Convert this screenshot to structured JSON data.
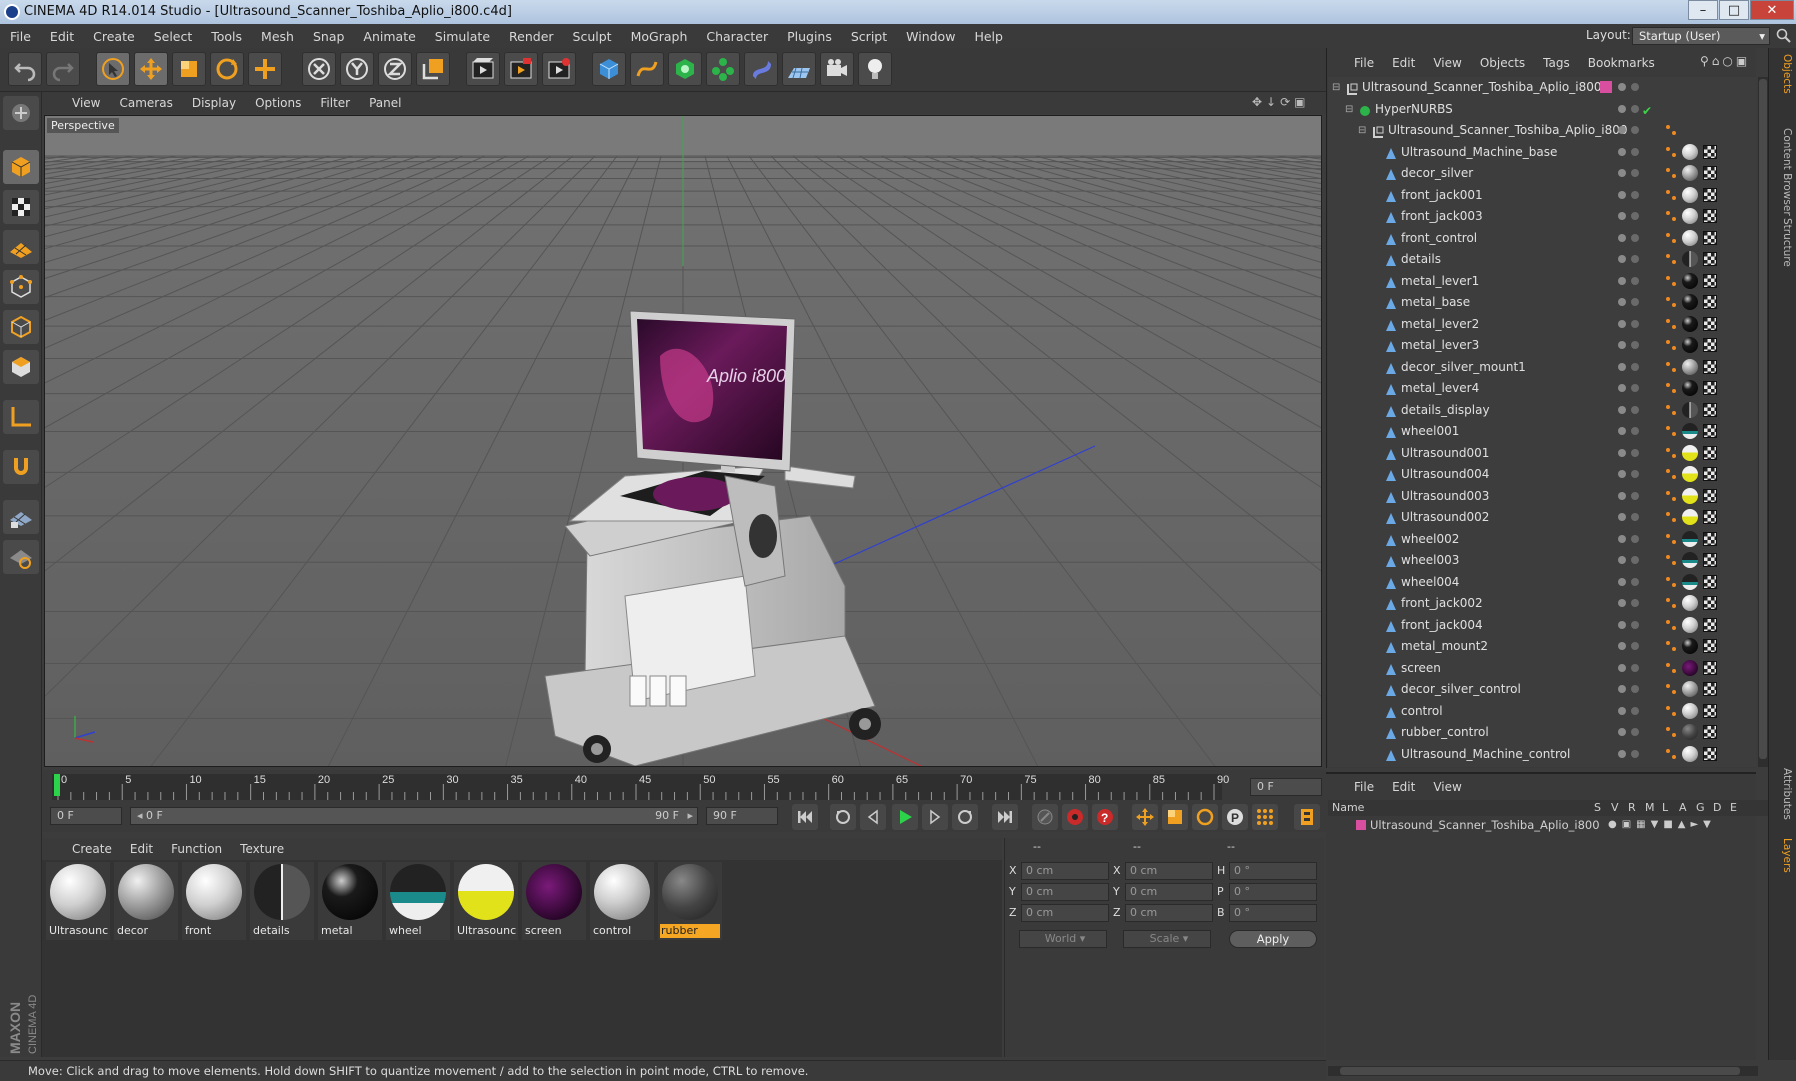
{
  "window": {
    "title": "CINEMA 4D R14.014 Studio - [Ultrasound_Scanner_Toshiba_Aplio_i800.c4d]"
  },
  "menubar": [
    "File",
    "Edit",
    "Create",
    "Select",
    "Tools",
    "Mesh",
    "Snap",
    "Animate",
    "Simulate",
    "Render",
    "Sculpt",
    "MoGraph",
    "Character",
    "Plugins",
    "Script",
    "Window",
    "Help"
  ],
  "layout": {
    "label": "Layout:",
    "value": "Startup (User)"
  },
  "viewport": {
    "menu": [
      "View",
      "Cameras",
      "Display",
      "Options",
      "Filter",
      "Panel"
    ],
    "label": "Perspective",
    "screen_text": "Aplio i800"
  },
  "timeline": {
    "ticks": [
      "0",
      "5",
      "10",
      "15",
      "20",
      "25",
      "30",
      "35",
      "40",
      "45",
      "50",
      "55",
      "60",
      "65",
      "70",
      "75",
      "80",
      "85",
      "90"
    ],
    "end_field": "0 F"
  },
  "playback": {
    "current": "0 F",
    "range_start": "0 F",
    "range_end": "90 F",
    "max": "90 F"
  },
  "materials": {
    "menu": [
      "Create",
      "Edit",
      "Function",
      "Texture"
    ],
    "items": [
      {
        "name": "Ultrasounc",
        "style": "white"
      },
      {
        "name": "decor",
        "style": "silver"
      },
      {
        "name": "front",
        "style": "white"
      },
      {
        "name": "details",
        "style": "details"
      },
      {
        "name": "metal",
        "style": "black"
      },
      {
        "name": "wheel",
        "style": "wheel"
      },
      {
        "name": "Ultrasounc",
        "style": "yellow"
      },
      {
        "name": "screen",
        "style": "screen"
      },
      {
        "name": "control",
        "style": "control"
      },
      {
        "name": "rubber",
        "style": "rubber"
      }
    ]
  },
  "coords": {
    "headers": [
      "--",
      "--",
      "--"
    ],
    "rows": [
      {
        "l1": "X",
        "v1": "0 cm",
        "l2": "X",
        "v2": "0 cm",
        "l3": "H",
        "v3": "0 °"
      },
      {
        "l1": "Y",
        "v1": "0 cm",
        "l2": "Y",
        "v2": "0 cm",
        "l3": "P",
        "v3": "0 °"
      },
      {
        "l1": "Z",
        "v1": "0 cm",
        "l2": "Z",
        "v2": "0 cm",
        "l3": "B",
        "v3": "0 °"
      }
    ],
    "world": "World",
    "scale": "Scale",
    "apply": "Apply"
  },
  "status": "Move: Click and drag to move elements. Hold down SHIFT to quantize movement / add to the selection in point mode, CTRL to remove.",
  "objects": {
    "menu": [
      "File",
      "Edit",
      "View",
      "Objects",
      "Tags",
      "Bookmarks"
    ],
    "rows": [
      {
        "name": "Ultrasound_Scanner_Toshiba_Aplio_i800",
        "indent": 0,
        "type": "null",
        "mat": "pink"
      },
      {
        "name": "HyperNURBS",
        "indent": 1,
        "type": "nurbs",
        "mat": "check"
      },
      {
        "name": "Ultrasound_Scanner_Toshiba_Aplio_i800",
        "indent": 2,
        "type": "null",
        "mat": "none"
      },
      {
        "name": "Ultrasound_Machine_base",
        "indent": 3,
        "type": "poly",
        "mat": "white"
      },
      {
        "name": "decor_silver",
        "indent": 3,
        "type": "poly",
        "mat": "silver"
      },
      {
        "name": "front_jack001",
        "indent": 3,
        "type": "poly",
        "mat": "white"
      },
      {
        "name": "front_jack003",
        "indent": 3,
        "type": "poly",
        "mat": "white"
      },
      {
        "name": "front_control",
        "indent": 3,
        "type": "poly",
        "mat": "white"
      },
      {
        "name": "details",
        "indent": 3,
        "type": "poly",
        "mat": "details"
      },
      {
        "name": "metal_lever1",
        "indent": 3,
        "type": "poly",
        "mat": "black"
      },
      {
        "name": "metal_base",
        "indent": 3,
        "type": "poly",
        "mat": "black"
      },
      {
        "name": "metal_lever2",
        "indent": 3,
        "type": "poly",
        "mat": "black"
      },
      {
        "name": "metal_lever3",
        "indent": 3,
        "type": "poly",
        "mat": "black"
      },
      {
        "name": "decor_silver_mount1",
        "indent": 3,
        "type": "poly",
        "mat": "silver"
      },
      {
        "name": "metal_lever4",
        "indent": 3,
        "type": "poly",
        "mat": "black"
      },
      {
        "name": "details_display",
        "indent": 3,
        "type": "poly",
        "mat": "details"
      },
      {
        "name": "wheel001",
        "indent": 3,
        "type": "poly",
        "mat": "wheel"
      },
      {
        "name": "Ultrasound001",
        "indent": 3,
        "type": "poly",
        "mat": "yellow"
      },
      {
        "name": "Ultrasound004",
        "indent": 3,
        "type": "poly",
        "mat": "yellow"
      },
      {
        "name": "Ultrasound003",
        "indent": 3,
        "type": "poly",
        "mat": "yellow"
      },
      {
        "name": "Ultrasound002",
        "indent": 3,
        "type": "poly",
        "mat": "yellow"
      },
      {
        "name": "wheel002",
        "indent": 3,
        "type": "poly",
        "mat": "wheel"
      },
      {
        "name": "wheel003",
        "indent": 3,
        "type": "poly",
        "mat": "wheel"
      },
      {
        "name": "wheel004",
        "indent": 3,
        "type": "poly",
        "mat": "wheel"
      },
      {
        "name": "front_jack002",
        "indent": 3,
        "type": "poly",
        "mat": "white"
      },
      {
        "name": "front_jack004",
        "indent": 3,
        "type": "poly",
        "mat": "white"
      },
      {
        "name": "metal_mount2",
        "indent": 3,
        "type": "poly",
        "mat": "black"
      },
      {
        "name": "screen",
        "indent": 3,
        "type": "poly",
        "mat": "screen"
      },
      {
        "name": "decor_silver_control",
        "indent": 3,
        "type": "poly",
        "mat": "silver"
      },
      {
        "name": "control",
        "indent": 3,
        "type": "poly",
        "mat": "control"
      },
      {
        "name": "rubber_control",
        "indent": 3,
        "type": "poly",
        "mat": "rubber"
      },
      {
        "name": "Ultrasound_Machine_control",
        "indent": 3,
        "type": "poly",
        "mat": "white"
      }
    ]
  },
  "layers": {
    "menu": [
      "File",
      "Edit",
      "View"
    ],
    "header_name": "Name",
    "cols": [
      "S",
      "V",
      "R",
      "M",
      "L",
      "A",
      "G",
      "D",
      "E"
    ],
    "row": "Ultrasound_Scanner_Toshiba_Aplio_i800"
  },
  "side_tabs": [
    "Objects",
    "Content Browser",
    "Structure",
    "Attributes",
    "Layers"
  ],
  "brand": {
    "maxon": "MAXON",
    "c4d": "CINEMA 4D"
  },
  "colors": {
    "accent": "#f0a020",
    "select_orange": "#f5a623",
    "layer_pink": "#d94fa0"
  }
}
